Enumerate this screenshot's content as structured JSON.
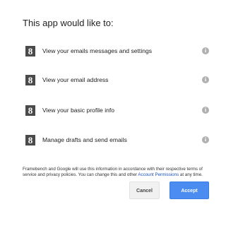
{
  "dialog": {
    "heading": "This app would like to:",
    "permissions": [
      {
        "icon": "google-icon",
        "icon_glyph": "8",
        "label": "View your emails messages and settings",
        "info_icon": "info-icon",
        "info_glyph": "i"
      },
      {
        "icon": "google-icon",
        "icon_glyph": "8",
        "label": "View your email address",
        "info_icon": "info-icon",
        "info_glyph": "i"
      },
      {
        "icon": "google-icon",
        "icon_glyph": "8",
        "label": "View your basic profile info",
        "info_icon": "info-icon",
        "info_glyph": "i"
      },
      {
        "icon": "google-icon",
        "icon_glyph": "8",
        "label": "Manage drafts and send emails",
        "info_icon": "info-icon",
        "info_glyph": "i"
      }
    ],
    "disclaimer": {
      "text_before": "Framebench and Google will use this information in accordance with their respective terms of service and privacy policies. You can change this and other ",
      "link_text": "Account Permissions",
      "text_after": " at any time."
    },
    "buttons": {
      "cancel_label": "Cancel",
      "accept_label": "Accept"
    },
    "colors": {
      "accent": "#4a8cf0",
      "link": "#1a4fbf",
      "icon_bg": "#4a4a4a",
      "info_icon": "#b0b0b0"
    }
  }
}
